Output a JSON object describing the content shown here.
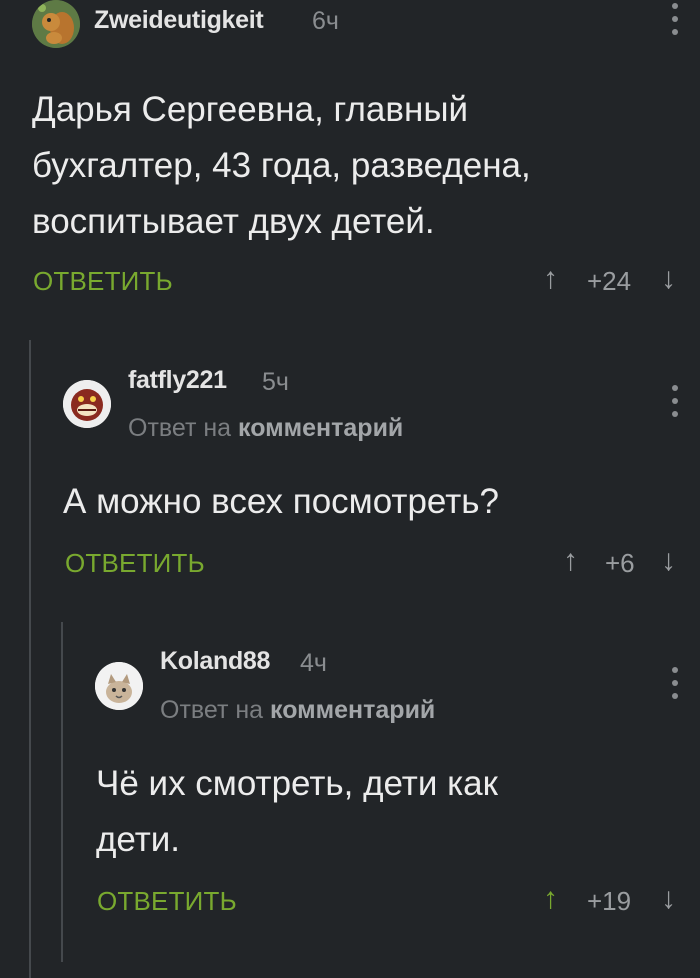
{
  "comments": [
    {
      "author": "Zweideutigkeit",
      "time": "6ч",
      "reply_to_prefix": "",
      "reply_to_target": "",
      "body": [
        "Дарья Сергеевна, главный",
        "бухгалтер, 43 года, разведена,",
        "воспитывает двух детей."
      ],
      "reply_label": "ОТВЕТИТЬ",
      "rating": "+24",
      "avatar": "squirrel-avatar"
    },
    {
      "author": "fatfly221",
      "time": "5ч",
      "reply_to_prefix": "Ответ на",
      "reply_to_target": "комментарий",
      "body": [
        "А можно всех посмотреть?"
      ],
      "reply_label": "ОТВЕТИТЬ",
      "rating": "+6",
      "avatar": "monster-avatar"
    },
    {
      "author": "Koland88",
      "time": "4ч",
      "reply_to_prefix": "Ответ на",
      "reply_to_target": "комментарий",
      "body": [
        "Чё их смотреть, дети как",
        "дети."
      ],
      "reply_label": "ОТВЕТИТЬ",
      "rating": "+19",
      "avatar": "cat-avatar"
    }
  ],
  "colors": {
    "background": "#222528",
    "accent_green": "#79a92f",
    "thread_line": "#45494d"
  }
}
